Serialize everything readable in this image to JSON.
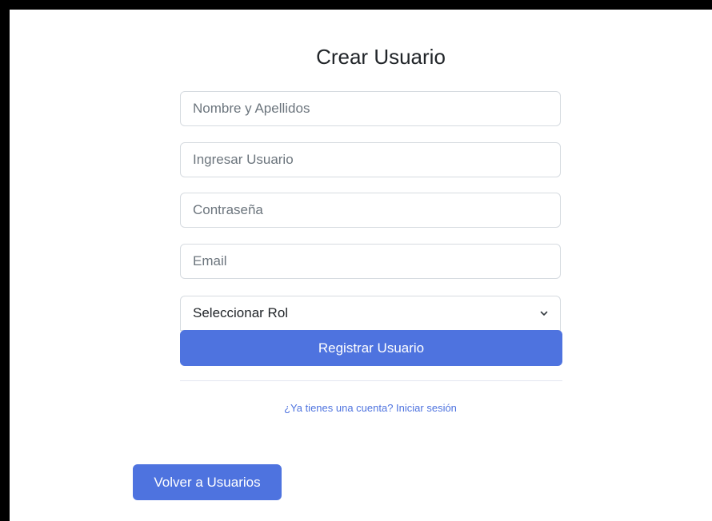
{
  "form": {
    "title": "Crear Usuario",
    "fields": {
      "nombre": {
        "placeholder": "Nombre y Apellidos",
        "value": ""
      },
      "usuario": {
        "placeholder": "Ingresar Usuario",
        "value": ""
      },
      "contrasena": {
        "placeholder": "Contraseña",
        "value": ""
      },
      "email": {
        "placeholder": "Email",
        "value": ""
      }
    },
    "rol_select": {
      "selected": "Seleccionar Rol",
      "icon": "chevron-down-icon"
    },
    "submit_label": "Registrar Usuario",
    "login_link": "¿Ya tienes una cuenta? Iniciar sesión"
  },
  "back_button_label": "Volver a Usuarios",
  "colors": {
    "primary": "#4e73df",
    "border": "#d6dbe0",
    "frame": "#000000"
  }
}
